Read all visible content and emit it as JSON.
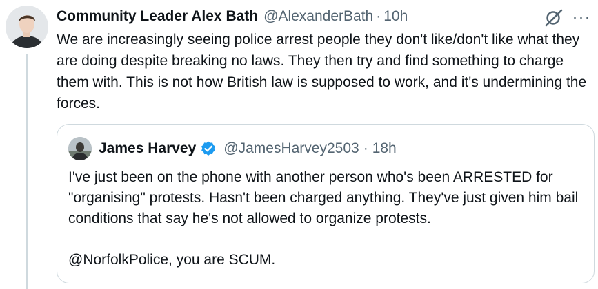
{
  "tweet": {
    "display_name": "Community Leader Alex Bath",
    "handle": "@AlexanderBath",
    "separator": "·",
    "time": "10h",
    "text": "We are increasingly seeing police arrest people they don't like/don't like what they are doing despite breaking no laws. They then try and find something to charge them with. This is not how British law is supposed to work, and it's undermining the forces.",
    "grok_icon": "grok-icon",
    "more_icon": "more-icon",
    "more_glyph": "···"
  },
  "quote": {
    "display_name": "James Harvey",
    "verified": true,
    "verified_color": "#1d9bf0",
    "handle": "@JamesHarvey2503",
    "separator": "·",
    "time": "18h",
    "text": "I've just been on the phone with another person who's been ARRESTED for \"organising\" protests. Hasn't been charged anything. They've just given him bail conditions that say he's not allowed to organize protests.\n\n@NorfolkPolice, you are SCUM."
  },
  "colors": {
    "text": "#0f1419",
    "secondary": "#536471",
    "border": "#cfd9de",
    "background": "#ffffff"
  }
}
